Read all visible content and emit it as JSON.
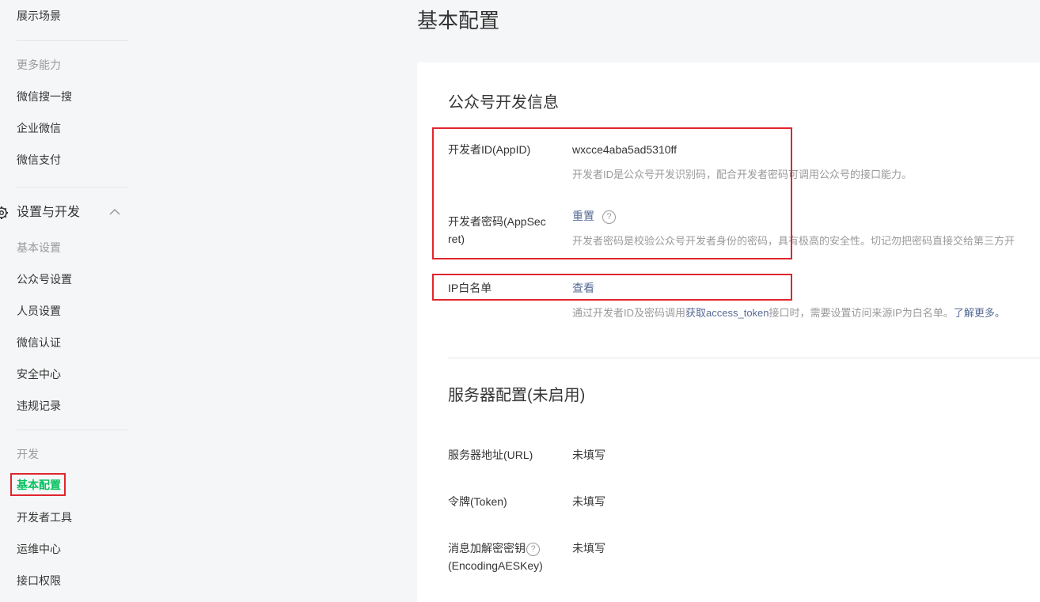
{
  "sidebar": {
    "top_item": "展示场景",
    "more_heading": "更多能力",
    "more_items": [
      "微信搜一搜",
      "企业微信",
      "微信支付"
    ],
    "group_label": "设置与开发",
    "settings_heading": "基本设置",
    "settings_items": [
      "公众号设置",
      "人员设置",
      "微信认证",
      "安全中心",
      "违规记录"
    ],
    "dev_heading": "开发",
    "dev_active": "基本配置",
    "dev_items": [
      "开发者工具",
      "运维中心",
      "接口权限"
    ],
    "active_color": "#07c160"
  },
  "page": {
    "title": "基本配置"
  },
  "dev_info": {
    "title": "公众号开发信息",
    "appid_label": "开发者ID(AppID)",
    "appid_value": "wxcce4aba5ad5310ff",
    "appid_desc": "开发者ID是公众号开发识别码，配合开发者密码可调用公众号的接口能力。",
    "secret_label_1": "开发者密码(AppSec",
    "secret_label_2": "ret)",
    "secret_action": "重置",
    "secret_help": "?",
    "secret_desc": "开发者密码是校验公众号开发者身份的密码，具有极高的安全性。切记勿把密码直接交给第三方开",
    "ip_label": "IP白名单",
    "ip_action": "查看",
    "ip_desc_1": "通过开发者ID及密码调用",
    "ip_desc_link": "获取access_token",
    "ip_desc_2": "接口时，需要设置访问来源IP为白名单。",
    "ip_desc_more": "了解更多。"
  },
  "server": {
    "title": "服务器配置(未启用)",
    "url_label": "服务器地址(URL)",
    "url_value": "未填写",
    "token_label": "令牌(Token)",
    "token_value": "未填写",
    "aes_label_1": "消息加解密密钥",
    "aes_help": "?",
    "aes_label_2": "(EncodingAESKey)",
    "aes_value": "未填写"
  },
  "colors": {
    "highlight_box": "#e0262d",
    "link": "#576b95"
  }
}
